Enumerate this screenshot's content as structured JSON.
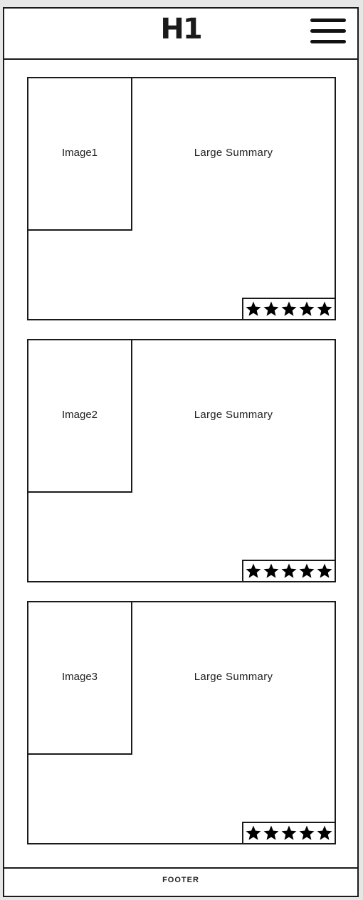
{
  "header": {
    "title": "H1",
    "menu_icon": "hamburger-menu-icon"
  },
  "cards": [
    {
      "image_label": "Image1",
      "summary": "Large Summary",
      "rating": 5
    },
    {
      "image_label": "Image2",
      "summary": "Large Summary",
      "rating": 5
    },
    {
      "image_label": "Image3",
      "summary": "Large Summary",
      "rating": 5
    }
  ],
  "footer": {
    "label": "FOOTER"
  }
}
